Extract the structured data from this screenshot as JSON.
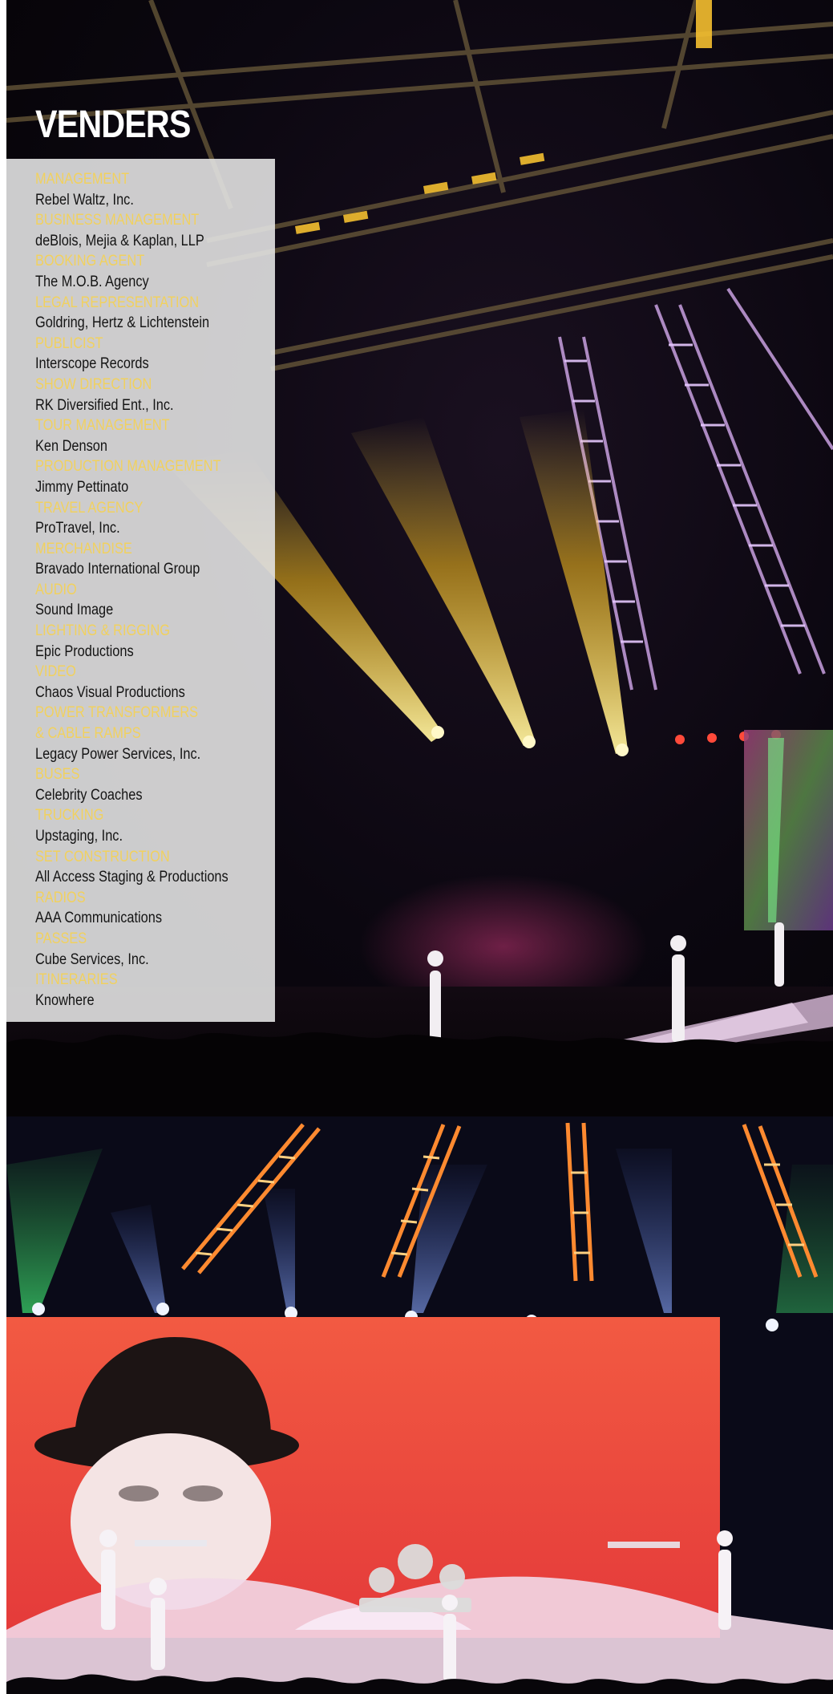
{
  "page": {
    "title": "VENDERS"
  },
  "vendors": [
    {
      "role": "MANAGEMENT",
      "role_cont": "",
      "name": "Rebel Waltz, Inc."
    },
    {
      "role": "BUSINESS MANAGEMENT",
      "role_cont": "",
      "name": "deBlois, Mejia & Kaplan, LLP"
    },
    {
      "role": "BOOKING AGENT",
      "role_cont": "",
      "name": "The M.O.B. Agency"
    },
    {
      "role": "LEGAL REPRESENTATION",
      "role_cont": "",
      "name": "Goldring, Hertz & Lichtenstein"
    },
    {
      "role": "PUBLICIST",
      "role_cont": "",
      "name": "Interscope Records"
    },
    {
      "role": "SHOW DIRECTION",
      "role_cont": "",
      "name": "RK Diversified Ent., Inc."
    },
    {
      "role": "TOUR MANAGEMENT",
      "role_cont": "",
      "name": "Ken Denson"
    },
    {
      "role": "PRODUCTION MANAGEMENT",
      "role_cont": "",
      "name": "Jimmy Pettinato"
    },
    {
      "role": "TRAVEL AGENCY",
      "role_cont": "",
      "name": "ProTravel, Inc."
    },
    {
      "role": "MERCHANDISE",
      "role_cont": "",
      "name": "Bravado International Group"
    },
    {
      "role": "AUDIO",
      "role_cont": "",
      "name": "Sound Image"
    },
    {
      "role": "LIGHTING & RIGGING",
      "role_cont": "",
      "name": "Epic Productions"
    },
    {
      "role": "VIDEO",
      "role_cont": "",
      "name": "Chaos Visual Productions"
    },
    {
      "role": "POWER TRANSFORMERS",
      "role_cont": "& CABLE RAMPS",
      "name": "Legacy Power Services, Inc."
    },
    {
      "role": "BUSES",
      "role_cont": "",
      "name": "Celebrity Coaches"
    },
    {
      "role": "TRUCKING",
      "role_cont": "",
      "name": "Upstaging, Inc."
    },
    {
      "role": "SET CONSTRUCTION",
      "role_cont": "",
      "name": "All Access Staging & Productions"
    },
    {
      "role": "RADIOS",
      "role_cont": "",
      "name": "AAA Communications"
    },
    {
      "role": "PASSES",
      "role_cont": "",
      "name": "Cube Services, Inc."
    },
    {
      "role": "ITINERARIES",
      "role_cont": "",
      "name": "Knowhere"
    }
  ],
  "colors": {
    "role_text": "#f8d24b",
    "name_text": "#141414",
    "panel_bg": "#e2e2e2",
    "heading_text": "#ffffff",
    "screen_red": "#f04a3a"
  }
}
